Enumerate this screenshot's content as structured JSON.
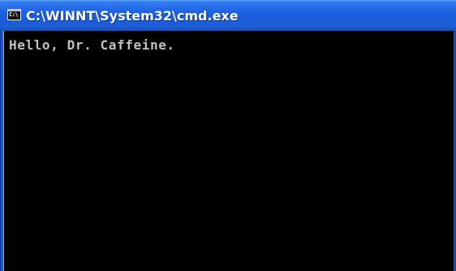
{
  "window": {
    "title": "C:\\WINNT\\System32\\cmd.exe",
    "icon": "console-icon",
    "icon_glyph": "C:\\"
  },
  "console": {
    "lines": [
      "Hello, Dr. Caffeine."
    ],
    "background_color": "#000000",
    "text_color": "#c0c0c0"
  },
  "colors": {
    "titlebar": "#1f63e0",
    "titlebar_text": "#ffffff"
  }
}
